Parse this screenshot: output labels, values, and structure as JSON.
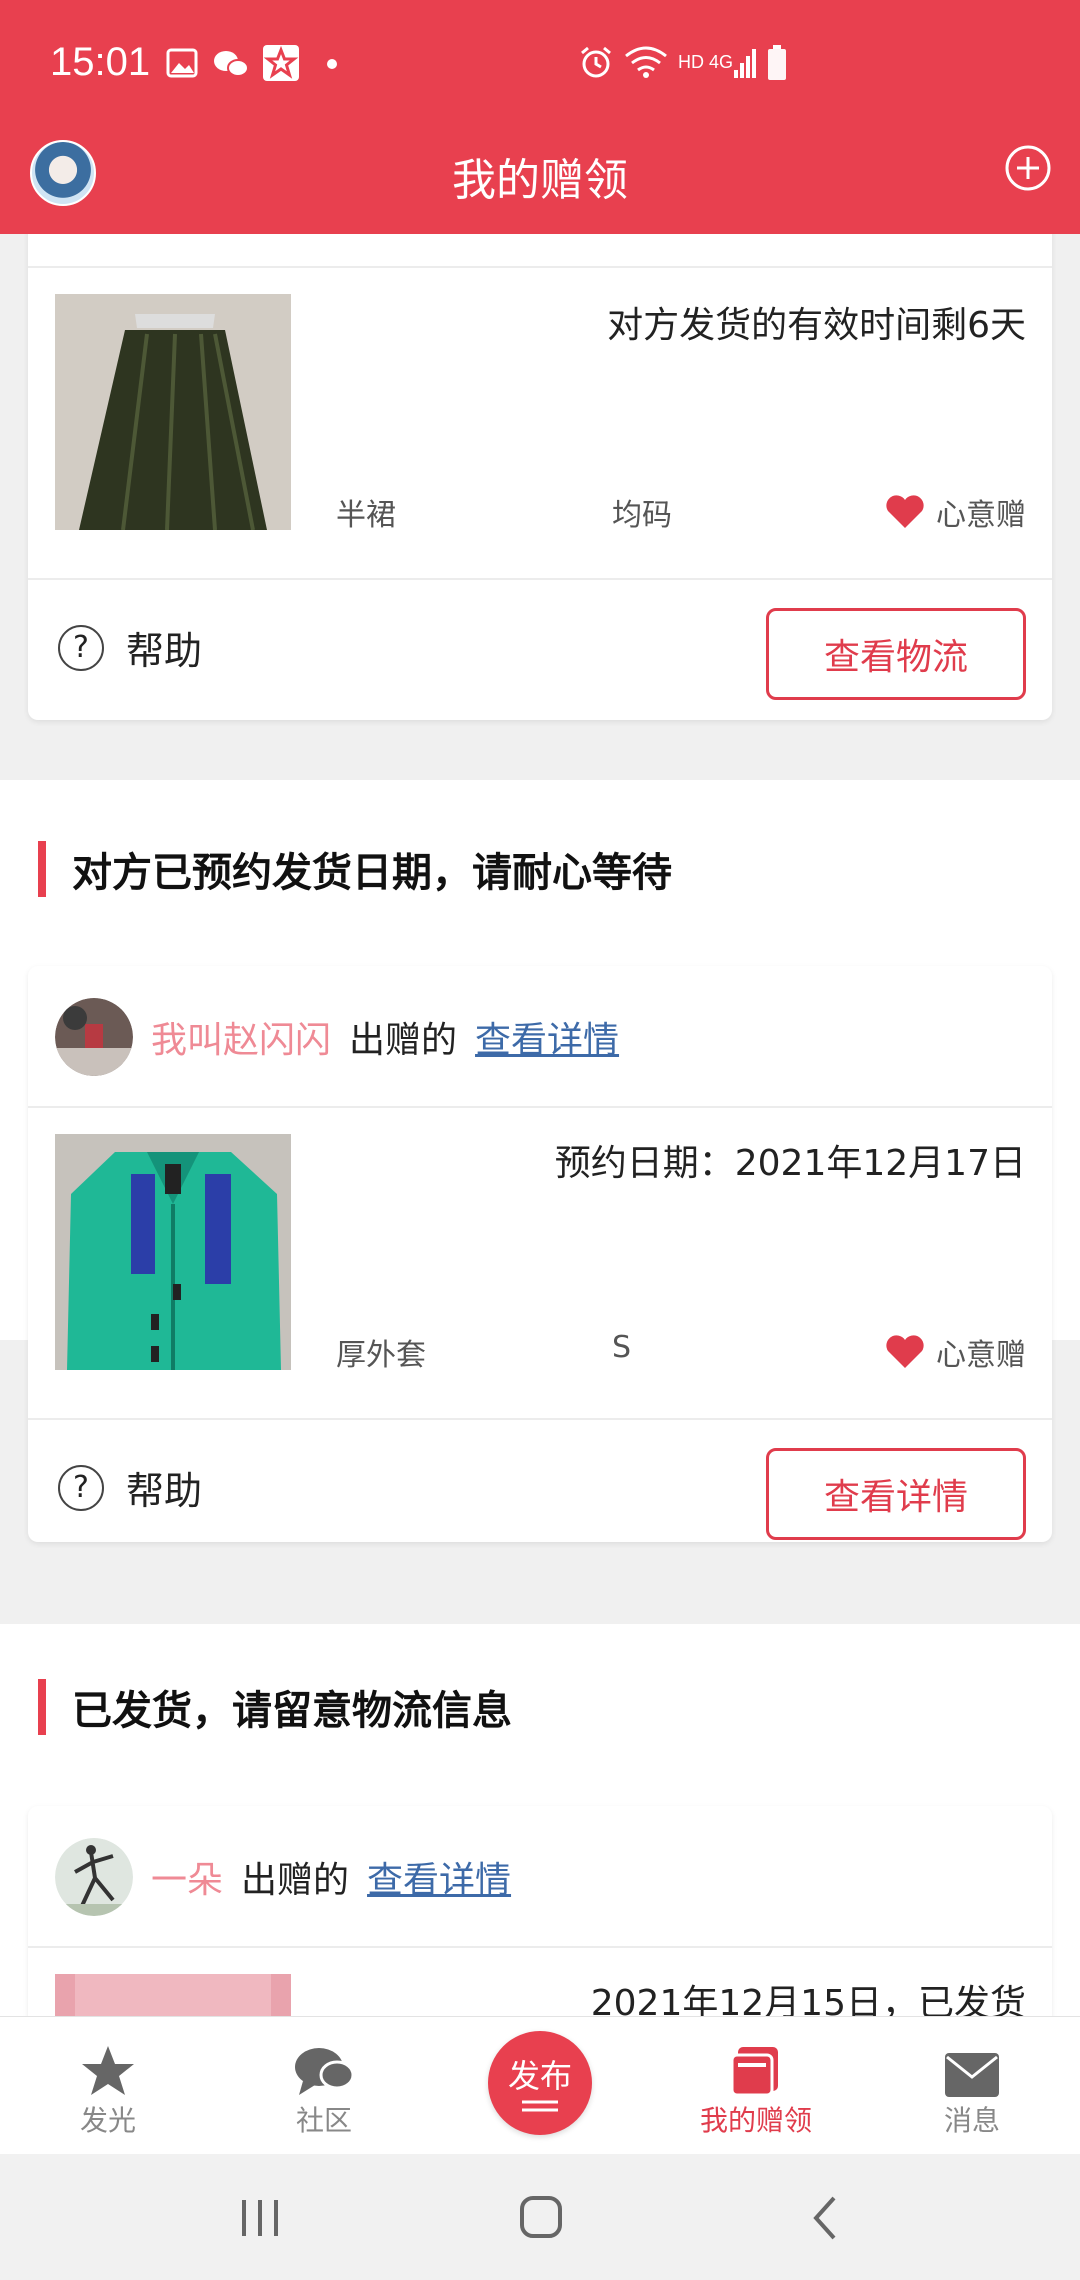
{
  "status_bar": {
    "time": "15:01",
    "network": "HD 4G"
  },
  "app_bar": {
    "title": "我的赠领"
  },
  "card1": {
    "deadline_text": "对方发货的有效时间剩6天",
    "category": "半裙",
    "size": "均码",
    "tag": "心意赠",
    "help_label": "帮助",
    "action_label": "查看物流"
  },
  "section2": {
    "title": "对方已预约发货日期，请耐心等待",
    "giver_name": "我叫赵闪闪",
    "gives_text": "出赠的",
    "detail_link": "查看详情",
    "schedule_text": "预约日期：2021年12月17日",
    "category": "厚外套",
    "size": "S",
    "tag": "心意赠",
    "help_label": "帮助",
    "action_label": "查看详情"
  },
  "section3": {
    "title": "已发货，请留意物流信息",
    "giver_name": "一朵",
    "gives_text": "出赠的",
    "detail_link": "查看详情",
    "shipped_text": "2021年12月15日，已发货"
  },
  "bottom_nav": {
    "items": [
      {
        "label": "发光",
        "icon": "star-icon"
      },
      {
        "label": "社区",
        "icon": "chat-icon"
      },
      {
        "label": "发布",
        "icon": "publish-icon"
      },
      {
        "label": "我的赠领",
        "icon": "gift-box-icon"
      },
      {
        "label": "消息",
        "icon": "mail-icon"
      }
    ],
    "active_index": 3
  },
  "colors": {
    "brand": "#e8404f",
    "link": "#3d6aa8",
    "giver_name": "#ef8a95"
  }
}
